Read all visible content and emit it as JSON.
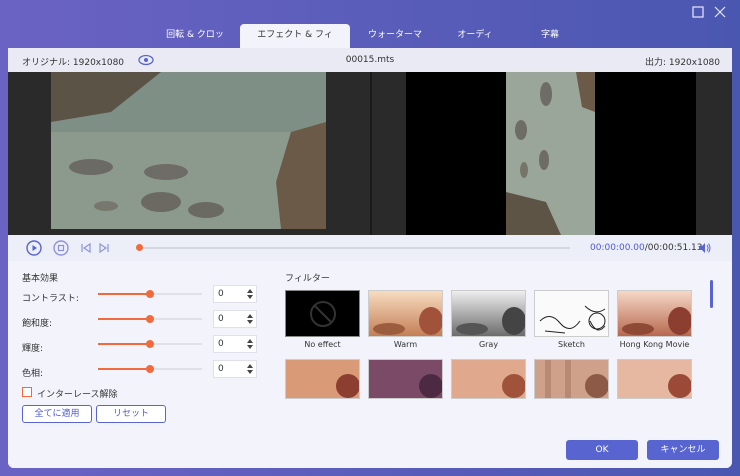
{
  "tabs": [
    {
      "label": "回転 & クロップ"
    },
    {
      "label": "エフェクト & フィルター"
    },
    {
      "label": "ウォーターマーク"
    },
    {
      "label": "オーディオ"
    },
    {
      "label": "字幕"
    }
  ],
  "active_tab": 1,
  "window_controls": {
    "maximize_icon": "maximize-icon",
    "close_icon": "close-icon"
  },
  "info": {
    "original": "オリジナル: 1920x1080",
    "filename": "00015.mts",
    "output": "出力: 1920x1080"
  },
  "playback": {
    "current": "00:00:00.00",
    "total": "/00:00:51.13",
    "progress": 0
  },
  "basic": {
    "title": "基本効果",
    "adjustments": [
      {
        "label": "コントラスト:",
        "value": "0",
        "level": 0.5
      },
      {
        "label": "飽和度:",
        "value": "0",
        "level": 0.5
      },
      {
        "label": "輝度:",
        "value": "0",
        "level": 0.5
      },
      {
        "label": "色相:",
        "value": "0",
        "level": 0.5
      }
    ],
    "deinterlace_label": "インターレース解除",
    "apply_all_label": "全てに適用",
    "reset_label": "リセット"
  },
  "filters": {
    "title": "フィルター",
    "items": [
      {
        "label": "No effect"
      },
      {
        "label": "Warm"
      },
      {
        "label": "Gray"
      },
      {
        "label": "Sketch"
      },
      {
        "label": "Hong Kong Movie"
      }
    ]
  },
  "buttons": {
    "ok": "OK",
    "cancel": "キャンセル"
  },
  "colors": {
    "accent": "#5865d0",
    "slider": "#f06a3c",
    "title_bar": "#5a5ab3"
  }
}
